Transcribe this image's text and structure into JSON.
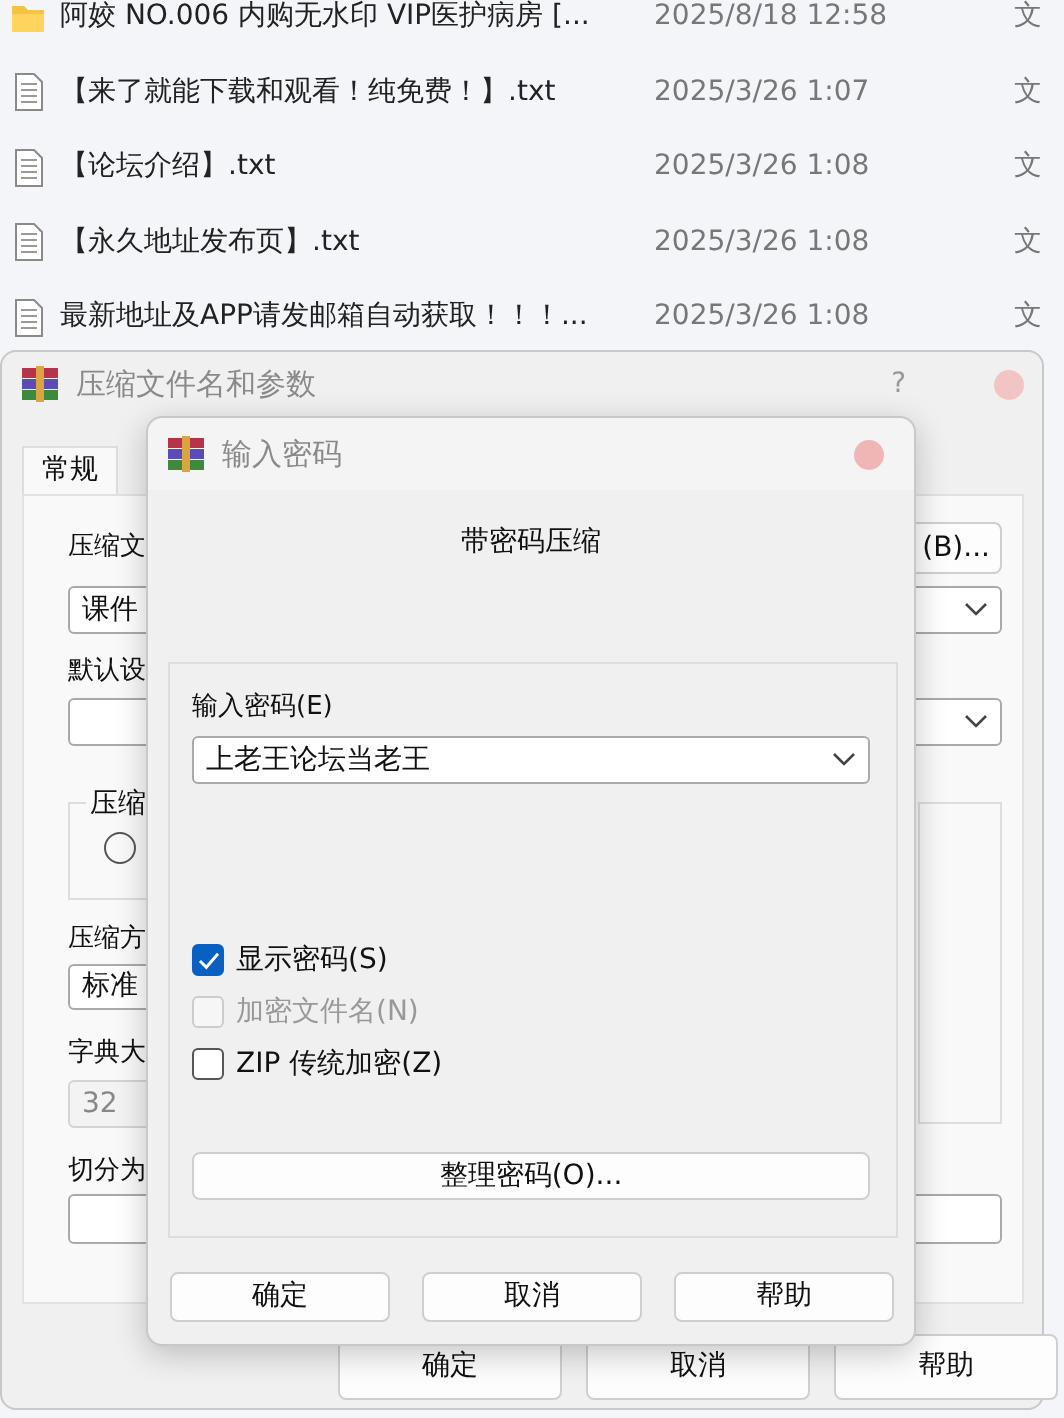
{
  "file_list": [
    {
      "kind": "folder",
      "name": "阿姣 NO.006 内购无水印 VIP医护病房 [...",
      "date": "2025/8/18 12:58",
      "type": "文"
    },
    {
      "kind": "text",
      "name": "【来了就能下载和观看！纯免费！】.txt",
      "date": "2025/3/26 1:07",
      "type": "文"
    },
    {
      "kind": "text",
      "name": "【论坛介绍】.txt",
      "date": "2025/3/26 1:08",
      "type": "文"
    },
    {
      "kind": "text",
      "name": "【永久地址发布页】.txt",
      "date": "2025/3/26 1:08",
      "type": "文"
    },
    {
      "kind": "text",
      "name": "最新地址及APP请发邮箱自动获取！！！...",
      "date": "2025/3/26 1:08",
      "type": "文"
    }
  ],
  "compress_dialog": {
    "title": "压缩文件名和参数",
    "help": "?",
    "tabs": [
      {
        "label": "常规",
        "selected": true
      }
    ],
    "archive_name": {
      "label": "压缩文",
      "value": "课件",
      "browse_button": "(B)..."
    },
    "profile": {
      "label": "默认设"
    },
    "format_group": {
      "label": "压缩",
      "radio": {
        "selected": false
      }
    },
    "method": {
      "label": "压缩方",
      "value": "标准"
    },
    "dictionary": {
      "label": "字典大",
      "value": "32",
      "disabled": true
    },
    "split": {
      "label": "切分为"
    },
    "buttons": [
      "确定",
      "取消",
      "帮助"
    ]
  },
  "password_dialog": {
    "title": "输入密码",
    "heading": "带密码压缩",
    "password": {
      "label": "输入密码(E)",
      "value": "上老王论坛当老王"
    },
    "options": [
      {
        "label": "显示密码(S)",
        "checked": true,
        "disabled": false
      },
      {
        "label": "加密文件名(N)",
        "checked": false,
        "disabled": true
      },
      {
        "label": "ZIP 传统加密(Z)",
        "checked": false,
        "disabled": false
      }
    ],
    "organize_button": "整理密码(O)...",
    "buttons": [
      "确定",
      "取消",
      "帮助"
    ]
  }
}
